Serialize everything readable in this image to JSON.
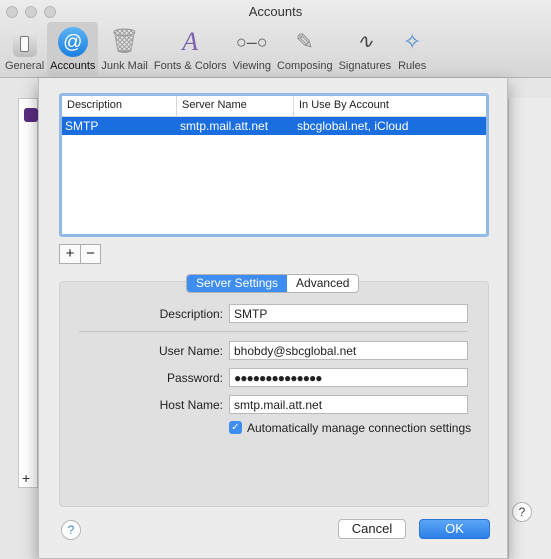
{
  "window": {
    "title": "Accounts"
  },
  "toolbar": {
    "items": [
      {
        "label": "General",
        "icon": "general-icon"
      },
      {
        "label": "Accounts",
        "icon": "at-sign-icon",
        "selected": true
      },
      {
        "label": "Junk Mail",
        "icon": "trash-icon"
      },
      {
        "label": "Fonts & Colors",
        "icon": "fonts-icon"
      },
      {
        "label": "Viewing",
        "icon": "glasses-icon"
      },
      {
        "label": "Composing",
        "icon": "pencil-icon"
      },
      {
        "label": "Signatures",
        "icon": "signature-icon"
      },
      {
        "label": "Rules",
        "icon": "rules-icon"
      }
    ]
  },
  "server_table": {
    "columns": [
      "Description",
      "Server Name",
      "In Use By Account"
    ],
    "rows": [
      {
        "description": "SMTP",
        "server_name": "smtp.mail.att.net",
        "in_use_by": "sbcglobal.net, iCloud",
        "selected": true
      }
    ],
    "add_label": "+",
    "remove_label": "−"
  },
  "tabs": {
    "server_settings": "Server Settings",
    "advanced": "Advanced",
    "active": "Server Settings"
  },
  "form": {
    "description_label": "Description:",
    "description_value": "SMTP",
    "username_label": "User Name:",
    "username_value": "bhobdy@sbcglobal.net",
    "password_label": "Password:",
    "password_value": "●●●●●●●●●●●●●●",
    "hostname_label": "Host Name:",
    "hostname_value": "smtp.mail.att.net",
    "auto_manage_label": "Automatically manage connection settings",
    "auto_manage_checked": true
  },
  "buttons": {
    "help": "?",
    "cancel": "Cancel",
    "ok": "OK"
  },
  "colors": {
    "accent": "#3d8ef0",
    "selection": "#1b6ee0"
  }
}
